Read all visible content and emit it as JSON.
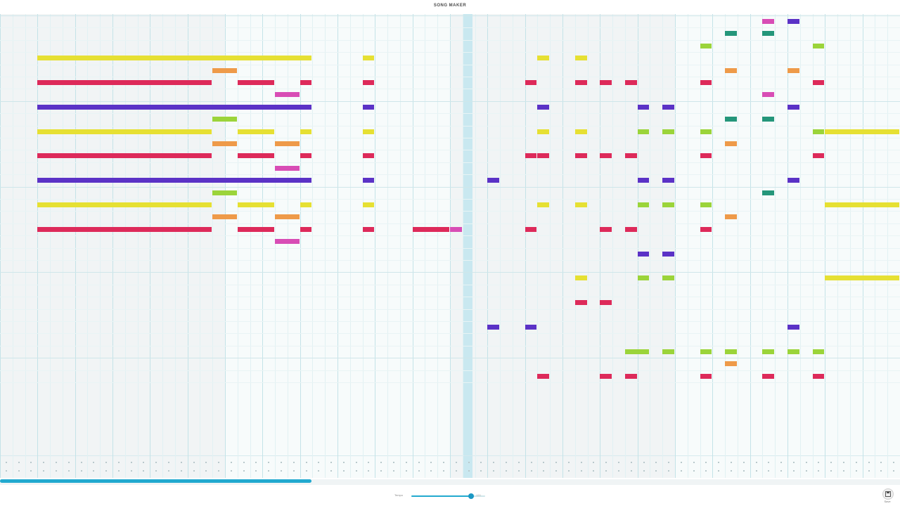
{
  "app": {
    "title": "SONG MAKER"
  },
  "grid": {
    "rows": 30,
    "columns": 72,
    "beats_per_measure": 3,
    "has_percussion": true
  },
  "playback": {
    "progress_pct": 34.6,
    "playhead_column": 37
  },
  "tempo": {
    "label": "Tempo",
    "value": "120",
    "level": 0.81
  },
  "toolbar": {
    "save_label": "Save",
    "save_icon": "save-icon"
  },
  "palette": {
    "yellow": "#e6e033",
    "orange": "#ee9a49",
    "crimson": "#dd2a5a",
    "magenta": "#d84db5",
    "violet": "#5b32c6",
    "lime": "#9bd43a",
    "teal": "#24967a",
    "accent": "#22a9cf"
  },
  "notes": [
    {
      "row": 3,
      "start": 3,
      "len": 22,
      "color": "yellow"
    },
    {
      "row": 4,
      "start": 17,
      "len": 2,
      "color": "orange"
    },
    {
      "row": 5,
      "start": 3,
      "len": 14,
      "color": "crimson"
    },
    {
      "row": 5,
      "start": 19,
      "len": 3,
      "color": "crimson"
    },
    {
      "row": 5,
      "start": 24,
      "len": 1,
      "color": "crimson"
    },
    {
      "row": 6,
      "start": 22,
      "len": 2,
      "color": "magenta"
    },
    {
      "row": 7,
      "start": 3,
      "len": 22,
      "color": "violet"
    },
    {
      "row": 9,
      "start": 3,
      "len": 14,
      "color": "yellow"
    },
    {
      "row": 8,
      "start": 17,
      "len": 2,
      "color": "lime"
    },
    {
      "row": 9,
      "start": 19,
      "len": 3,
      "color": "yellow"
    },
    {
      "row": 10,
      "start": 22,
      "len": 2,
      "color": "orange"
    },
    {
      "row": 9,
      "start": 24,
      "len": 1,
      "color": "yellow"
    },
    {
      "row": 10,
      "start": 17,
      "len": 2,
      "color": "orange"
    },
    {
      "row": 11,
      "start": 3,
      "len": 14,
      "color": "crimson"
    },
    {
      "row": 11,
      "start": 19,
      "len": 3,
      "color": "crimson"
    },
    {
      "row": 11,
      "start": 24,
      "len": 1,
      "color": "crimson"
    },
    {
      "row": 12,
      "start": 22,
      "len": 2,
      "color": "magenta"
    },
    {
      "row": 13,
      "start": 3,
      "len": 22,
      "color": "violet"
    },
    {
      "row": 15,
      "start": 3,
      "len": 14,
      "color": "yellow"
    },
    {
      "row": 14,
      "start": 17,
      "len": 2,
      "color": "lime"
    },
    {
      "row": 15,
      "start": 19,
      "len": 3,
      "color": "yellow"
    },
    {
      "row": 16,
      "start": 22,
      "len": 2,
      "color": "orange"
    },
    {
      "row": 15,
      "start": 24,
      "len": 1,
      "color": "yellow"
    },
    {
      "row": 16,
      "start": 17,
      "len": 2,
      "color": "orange"
    },
    {
      "row": 17,
      "start": 3,
      "len": 14,
      "color": "crimson"
    },
    {
      "row": 17,
      "start": 19,
      "len": 3,
      "color": "crimson"
    },
    {
      "row": 17,
      "start": 24,
      "len": 1,
      "color": "crimson"
    },
    {
      "row": 18,
      "start": 22,
      "len": 2,
      "color": "magenta"
    },
    {
      "row": 3,
      "start": 29,
      "len": 1,
      "color": "yellow"
    },
    {
      "row": 5,
      "start": 29,
      "len": 1,
      "color": "crimson"
    },
    {
      "row": 7,
      "start": 29,
      "len": 1,
      "color": "violet"
    },
    {
      "row": 9,
      "start": 29,
      "len": 1,
      "color": "yellow"
    },
    {
      "row": 11,
      "start": 29,
      "len": 1,
      "color": "crimson"
    },
    {
      "row": 13,
      "start": 29,
      "len": 1,
      "color": "violet"
    },
    {
      "row": 15,
      "start": 29,
      "len": 1,
      "color": "yellow"
    },
    {
      "row": 17,
      "start": 29,
      "len": 1,
      "color": "crimson"
    },
    {
      "row": 17,
      "start": 33,
      "len": 3,
      "color": "crimson"
    },
    {
      "row": 17,
      "start": 36,
      "len": 1,
      "color": "magenta"
    },
    {
      "row": 13,
      "start": 39,
      "len": 1,
      "color": "violet"
    },
    {
      "row": 25,
      "start": 39,
      "len": 1,
      "color": "violet"
    },
    {
      "row": 5,
      "start": 42,
      "len": 1,
      "color": "crimson"
    },
    {
      "row": 11,
      "start": 42,
      "len": 1,
      "color": "crimson"
    },
    {
      "row": 17,
      "start": 42,
      "len": 1,
      "color": "crimson"
    },
    {
      "row": 25,
      "start": 42,
      "len": 1,
      "color": "violet"
    },
    {
      "row": 3,
      "start": 43,
      "len": 1,
      "color": "yellow"
    },
    {
      "row": 7,
      "start": 43,
      "len": 1,
      "color": "violet"
    },
    {
      "row": 9,
      "start": 43,
      "len": 1,
      "color": "yellow"
    },
    {
      "row": 11,
      "start": 43,
      "len": 1,
      "color": "crimson"
    },
    {
      "row": 15,
      "start": 43,
      "len": 1,
      "color": "yellow"
    },
    {
      "row": 29,
      "start": 43,
      "len": 1,
      "color": "crimson"
    },
    {
      "row": 3,
      "start": 46,
      "len": 1,
      "color": "yellow"
    },
    {
      "row": 5,
      "start": 46,
      "len": 1,
      "color": "crimson"
    },
    {
      "row": 9,
      "start": 46,
      "len": 1,
      "color": "yellow"
    },
    {
      "row": 11,
      "start": 46,
      "len": 1,
      "color": "crimson"
    },
    {
      "row": 15,
      "start": 46,
      "len": 1,
      "color": "yellow"
    },
    {
      "row": 21,
      "start": 46,
      "len": 1,
      "color": "yellow"
    },
    {
      "row": 23,
      "start": 46,
      "len": 1,
      "color": "crimson"
    },
    {
      "row": 5,
      "start": 48,
      "len": 1,
      "color": "crimson"
    },
    {
      "row": 11,
      "start": 48,
      "len": 1,
      "color": "crimson"
    },
    {
      "row": 17,
      "start": 48,
      "len": 1,
      "color": "crimson"
    },
    {
      "row": 23,
      "start": 48,
      "len": 1,
      "color": "crimson"
    },
    {
      "row": 29,
      "start": 48,
      "len": 1,
      "color": "crimson"
    },
    {
      "row": 5,
      "start": 50,
      "len": 1,
      "color": "crimson"
    },
    {
      "row": 11,
      "start": 50,
      "len": 1,
      "color": "crimson"
    },
    {
      "row": 17,
      "start": 50,
      "len": 1,
      "color": "crimson"
    },
    {
      "row": 27,
      "start": 50,
      "len": 2,
      "color": "lime"
    },
    {
      "row": 29,
      "start": 50,
      "len": 1,
      "color": "crimson"
    },
    {
      "row": 7,
      "start": 51,
      "len": 1,
      "color": "violet"
    },
    {
      "row": 9,
      "start": 51,
      "len": 1,
      "color": "lime"
    },
    {
      "row": 13,
      "start": 51,
      "len": 1,
      "color": "violet"
    },
    {
      "row": 15,
      "start": 51,
      "len": 1,
      "color": "lime"
    },
    {
      "row": 19,
      "start": 51,
      "len": 1,
      "color": "violet"
    },
    {
      "row": 21,
      "start": 51,
      "len": 1,
      "color": "lime"
    },
    {
      "row": 7,
      "start": 53,
      "len": 1,
      "color": "violet"
    },
    {
      "row": 9,
      "start": 53,
      "len": 1,
      "color": "lime"
    },
    {
      "row": 13,
      "start": 53,
      "len": 1,
      "color": "violet"
    },
    {
      "row": 15,
      "start": 53,
      "len": 1,
      "color": "lime"
    },
    {
      "row": 19,
      "start": 53,
      "len": 1,
      "color": "violet"
    },
    {
      "row": 21,
      "start": 53,
      "len": 1,
      "color": "lime"
    },
    {
      "row": 27,
      "start": 53,
      "len": 1,
      "color": "lime"
    },
    {
      "row": 2,
      "start": 56,
      "len": 1,
      "color": "lime"
    },
    {
      "row": 5,
      "start": 56,
      "len": 1,
      "color": "crimson"
    },
    {
      "row": 9,
      "start": 56,
      "len": 1,
      "color": "lime"
    },
    {
      "row": 11,
      "start": 56,
      "len": 1,
      "color": "crimson"
    },
    {
      "row": 15,
      "start": 56,
      "len": 1,
      "color": "lime"
    },
    {
      "row": 17,
      "start": 56,
      "len": 1,
      "color": "crimson"
    },
    {
      "row": 27,
      "start": 56,
      "len": 1,
      "color": "lime"
    },
    {
      "row": 29,
      "start": 56,
      "len": 1,
      "color": "crimson"
    },
    {
      "row": 1,
      "start": 58,
      "len": 1,
      "color": "teal"
    },
    {
      "row": 4,
      "start": 58,
      "len": 1,
      "color": "orange"
    },
    {
      "row": 8,
      "start": 58,
      "len": 1,
      "color": "teal"
    },
    {
      "row": 10,
      "start": 58,
      "len": 1,
      "color": "orange"
    },
    {
      "row": 16,
      "start": 58,
      "len": 1,
      "color": "orange"
    },
    {
      "row": 27,
      "start": 58,
      "len": 1,
      "color": "lime"
    },
    {
      "row": 28,
      "start": 58,
      "len": 1,
      "color": "orange"
    },
    {
      "row": 0,
      "start": 61,
      "len": 1,
      "color": "magenta"
    },
    {
      "row": 1,
      "start": 61,
      "len": 1,
      "color": "teal"
    },
    {
      "row": 6,
      "start": 61,
      "len": 1,
      "color": "magenta"
    },
    {
      "row": 8,
      "start": 61,
      "len": 1,
      "color": "teal"
    },
    {
      "row": 14,
      "start": 61,
      "len": 1,
      "color": "teal"
    },
    {
      "row": 27,
      "start": 61,
      "len": 1,
      "color": "lime"
    },
    {
      "row": 29,
      "start": 61,
      "len": 1,
      "color": "crimson"
    },
    {
      "row": 0,
      "start": 63,
      "len": 1,
      "color": "violet"
    },
    {
      "row": 4,
      "start": 63,
      "len": 1,
      "color": "orange"
    },
    {
      "row": 7,
      "start": 63,
      "len": 1,
      "color": "violet"
    },
    {
      "row": 13,
      "start": 63,
      "len": 1,
      "color": "violet"
    },
    {
      "row": 25,
      "start": 63,
      "len": 1,
      "color": "violet"
    },
    {
      "row": 27,
      "start": 63,
      "len": 1,
      "color": "lime"
    },
    {
      "row": 2,
      "start": 65,
      "len": 1,
      "color": "lime"
    },
    {
      "row": 5,
      "start": 65,
      "len": 1,
      "color": "crimson"
    },
    {
      "row": 9,
      "start": 65,
      "len": 1,
      "color": "lime"
    },
    {
      "row": 11,
      "start": 65,
      "len": 1,
      "color": "crimson"
    },
    {
      "row": 27,
      "start": 65,
      "len": 1,
      "color": "lime"
    },
    {
      "row": 29,
      "start": 65,
      "len": 1,
      "color": "crimson"
    },
    {
      "row": 9,
      "start": 66,
      "len": 6,
      "color": "yellow"
    },
    {
      "row": 15,
      "start": 66,
      "len": 6,
      "color": "yellow"
    },
    {
      "row": 21,
      "start": 66,
      "len": 6,
      "color": "yellow"
    }
  ]
}
